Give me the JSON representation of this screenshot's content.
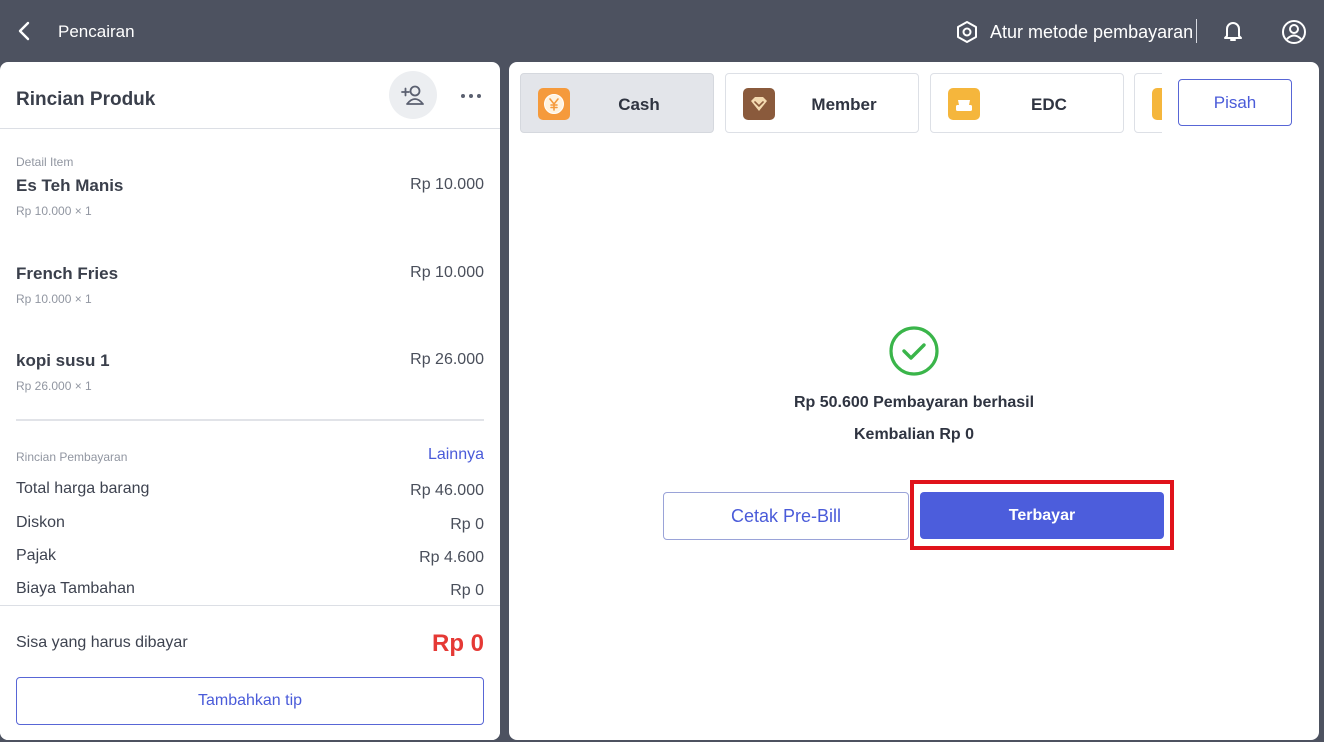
{
  "header": {
    "title": "Pencairan",
    "payment_settings_label": "Atur metode pembayaran"
  },
  "product_panel": {
    "title": "Rincian Produk",
    "detail_label": "Detail Item",
    "items": [
      {
        "name": "Es Teh Manis",
        "price": "Rp 10.000",
        "sub": "Rp 10.000  ×  1"
      },
      {
        "name": "French Fries",
        "price": "Rp 10.000",
        "sub": "Rp 10.000  ×  1"
      },
      {
        "name": "kopi susu 1",
        "price": "Rp 26.000",
        "sub": "Rp 26.000  ×  1"
      }
    ],
    "payment_label": "Rincian Pembayaran",
    "more_link": "Lainnya",
    "rows": [
      {
        "label": "Total harga barang",
        "value": "Rp 46.000"
      },
      {
        "label": "Diskon",
        "value": "Rp 0"
      },
      {
        "label": "Pajak",
        "value": "Rp 4.600"
      },
      {
        "label": "Biaya Tambahan",
        "value": "Rp 0"
      }
    ],
    "remaining_label": "Sisa yang harus dibayar",
    "remaining_value": "Rp 0",
    "tip_button": "Tambahkan tip"
  },
  "payment_panel": {
    "methods": [
      {
        "label": "Cash",
        "icon": "cash-yen-icon",
        "color": "#f59a3c",
        "active": true
      },
      {
        "label": "Member",
        "icon": "member-diamond-icon",
        "color": "#8a5a3c",
        "active": false
      },
      {
        "label": "EDC",
        "icon": "edc-card-icon",
        "color": "#f5b63c",
        "active": false
      },
      {
        "label": "",
        "icon": "partial-method-icon",
        "color": "#f5b63c",
        "active": false
      }
    ],
    "split_button": "Pisah",
    "success_message": "Rp 50.600 Pembayaran berhasil",
    "change_message": "Kembalian Rp 0",
    "prebill_button": "Cetak Pre-Bill",
    "paid_button": "Terbayar"
  },
  "colors": {
    "accent": "#4c5ddc",
    "success": "#3ab54a",
    "danger": "#e53935",
    "highlight": "#e0121b",
    "topbar": "#4d5260"
  }
}
